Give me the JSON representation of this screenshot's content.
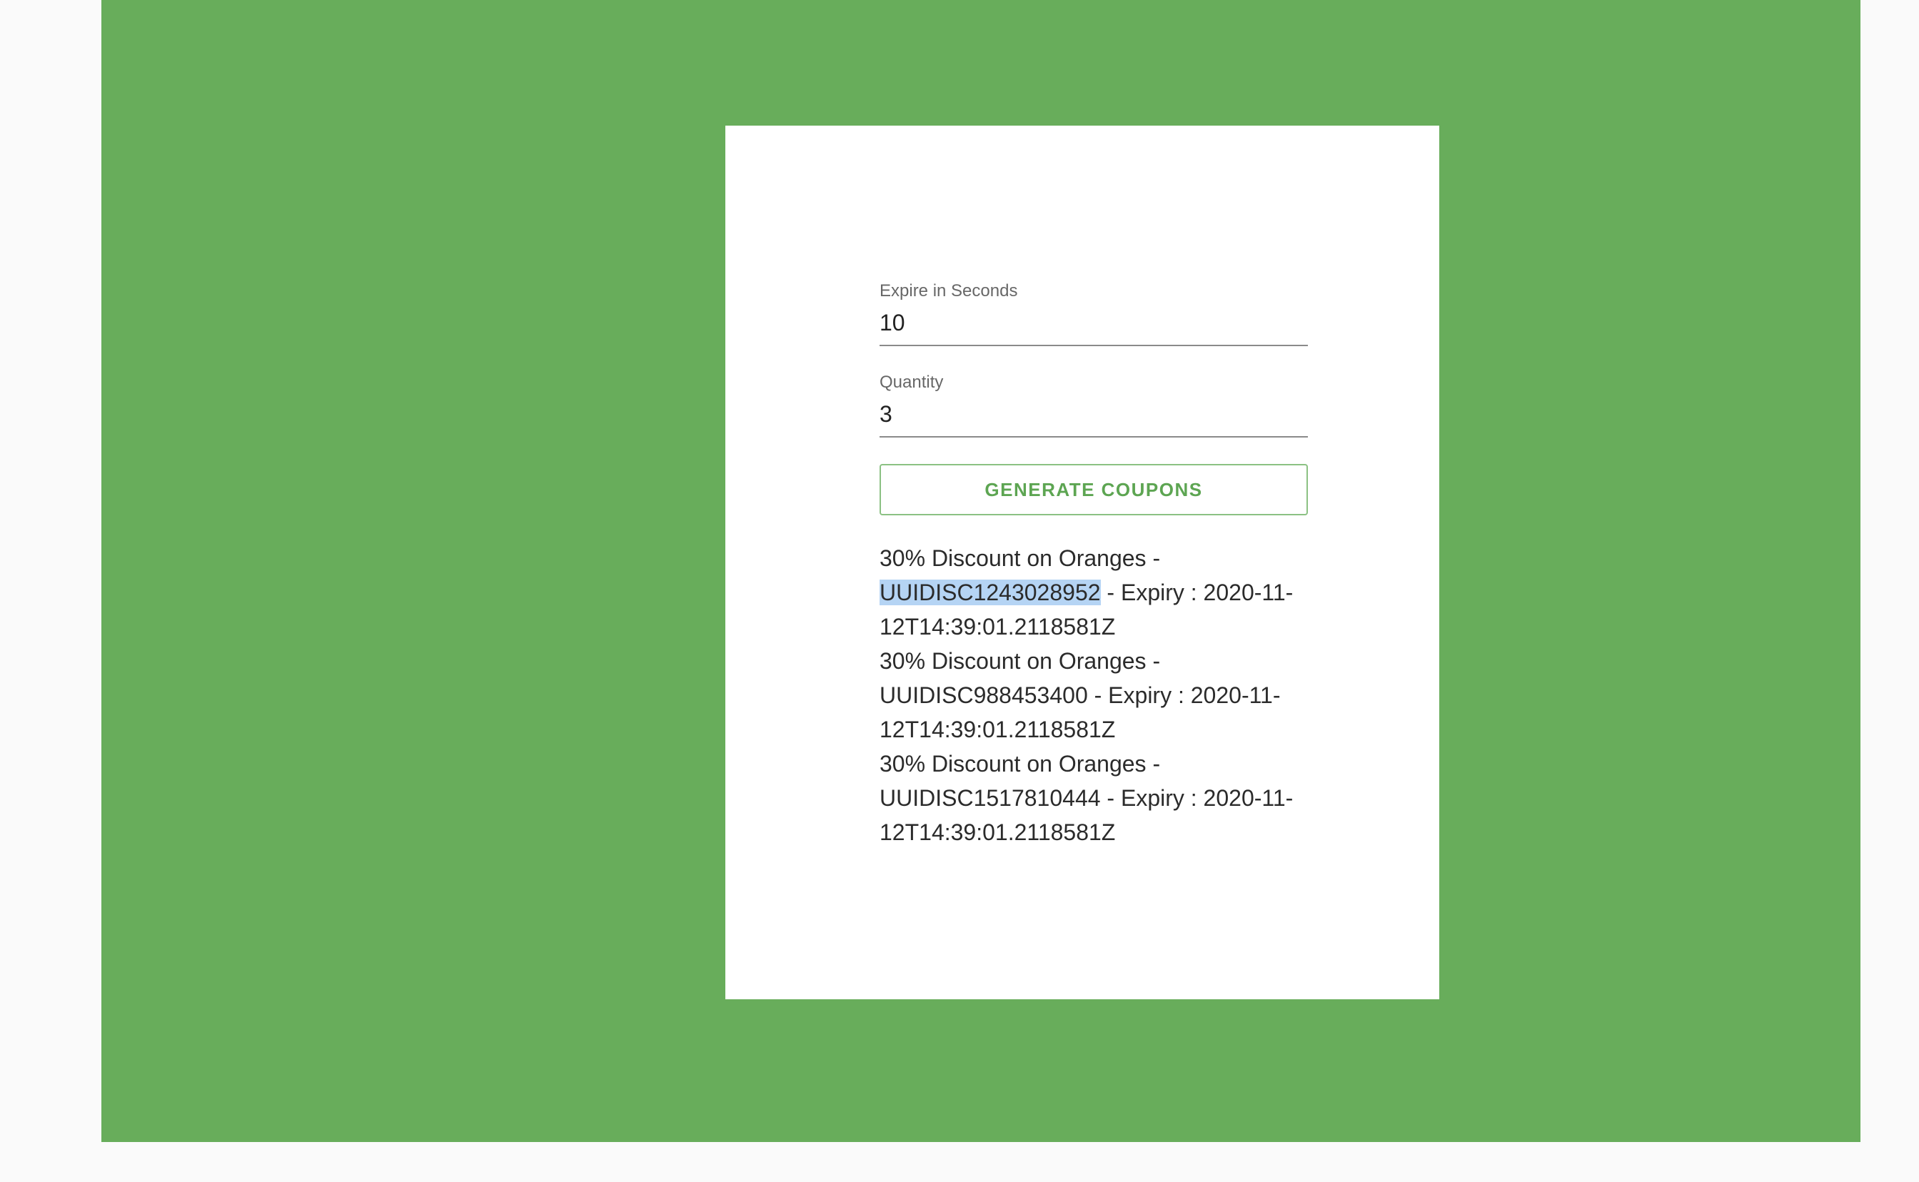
{
  "form": {
    "expire": {
      "label": "Expire in Seconds",
      "value": "10"
    },
    "quantity": {
      "label": "Quantity",
      "value": "3"
    },
    "generate_label": "GENERATE COUPONS"
  },
  "coupons": [
    {
      "prefix": "30% Discount on Oranges - ",
      "code": "UUIDISC1243028952",
      "suffix": " - Expiry : 2020-11-12T14:39:01.2118581Z",
      "selected": true
    },
    {
      "prefix": "30% Discount on Oranges - ",
      "code": "UUIDISC988453400",
      "suffix": " - Expiry : 2020-11-12T14:39:01.2118581Z",
      "selected": false
    },
    {
      "prefix": "30% Discount on Oranges - ",
      "code": "UUIDISC1517810444",
      "suffix": " - Expiry : 2020-11-12T14:39:01.2118581Z",
      "selected": false
    }
  ],
  "colors": {
    "background": "#68ad5b",
    "accent": "#5da552",
    "selection": "#b5d4f4"
  }
}
